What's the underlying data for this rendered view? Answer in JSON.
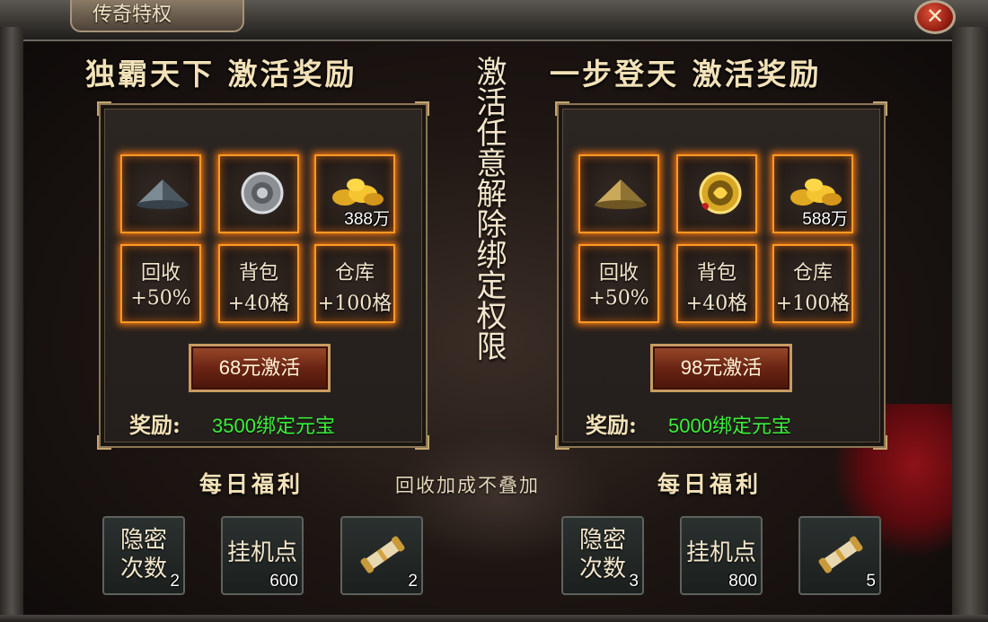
{
  "window": {
    "title": "传奇特权",
    "close_icon": "close-icon"
  },
  "center_vertical_text": "激活任意解除绑定权限",
  "left_package": {
    "heading": "独霸天下 激活奖励",
    "items": [
      {
        "icon": "bamboo-hat-icon",
        "quantity": ""
      },
      {
        "icon": "amulet-icon",
        "quantity": ""
      },
      {
        "icon": "gold-coins-icon",
        "quantity": "388万"
      }
    ],
    "benefits": [
      {
        "name": "回收",
        "value": "+50%"
      },
      {
        "name": "背包",
        "value": "+40格"
      },
      {
        "name": "仓库",
        "value": "+100格"
      }
    ],
    "activate_button": "68元激活",
    "reward_label": "奖励:",
    "reward_value": "3500绑定元宝",
    "daily_title": "每日福利",
    "daily": [
      {
        "line1": "隐密",
        "line2": "次数",
        "quantity": "2"
      },
      {
        "line1": "挂机点",
        "line2": "",
        "quantity": "600"
      },
      {
        "icon": "scroll-icon",
        "quantity": "2"
      }
    ]
  },
  "right_package": {
    "heading": "一步登天 激活奖励",
    "items": [
      {
        "icon": "golden-hat-icon",
        "quantity": ""
      },
      {
        "icon": "dragon-medallion-icon",
        "quantity": ""
      },
      {
        "icon": "gold-coins-icon",
        "quantity": "588万"
      }
    ],
    "benefits": [
      {
        "name": "回收",
        "value": "+50%"
      },
      {
        "name": "背包",
        "value": "+40格"
      },
      {
        "name": "仓库",
        "value": "+100格"
      }
    ],
    "activate_button": "98元激活",
    "reward_label": "奖励:",
    "reward_value": "5000绑定元宝",
    "daily_title": "每日福利",
    "daily": [
      {
        "line1": "隐密",
        "line2": "次数",
        "quantity": "3"
      },
      {
        "line1": "挂机点",
        "line2": "",
        "quantity": "800"
      },
      {
        "icon": "scroll-icon",
        "quantity": "5"
      }
    ]
  },
  "note": "回收加成不叠加",
  "colors": {
    "reward_green": "#3cf03c",
    "slot_glow": "#ff9a22",
    "heading": "#f3e2b8"
  }
}
